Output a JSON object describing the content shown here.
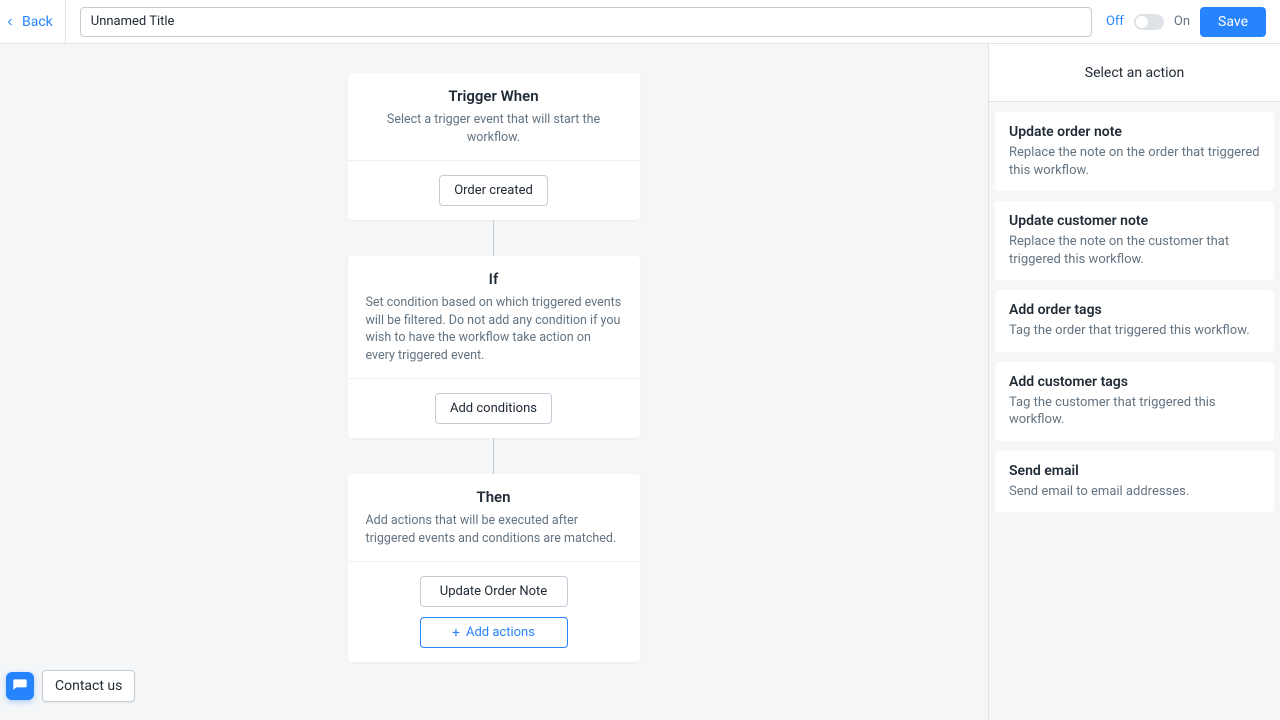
{
  "topbar": {
    "back": "Back",
    "title": "Unnamed Title",
    "off": "Off",
    "on": "On",
    "save": "Save"
  },
  "blocks": {
    "trigger": {
      "title": "Trigger When",
      "desc": "Select a trigger event that will start the workflow.",
      "button": "Order created"
    },
    "if": {
      "title": "If",
      "desc": "Set condition based on which triggered events will be filtered. Do not add any condition if you wish to have the workflow take action on every triggered event.",
      "button": "Add conditions"
    },
    "then": {
      "title": "Then",
      "desc": "Add actions that will be executed after triggered events and conditions are matched.",
      "action_btn": "Update Order Note",
      "add_btn": "Add actions"
    }
  },
  "panel": {
    "header": "Select an action",
    "actions": [
      {
        "title": "Update order note",
        "desc": "Replace the note on the order that triggered this workflow."
      },
      {
        "title": "Update customer note",
        "desc": "Replace the note on the customer that triggered this workflow."
      },
      {
        "title": "Add order tags",
        "desc": "Tag the order that triggered this workflow."
      },
      {
        "title": "Add customer tags",
        "desc": "Tag the customer that triggered this workflow."
      },
      {
        "title": "Send email",
        "desc": "Send email to email addresses."
      }
    ]
  },
  "contact": {
    "label": "Contact us"
  }
}
